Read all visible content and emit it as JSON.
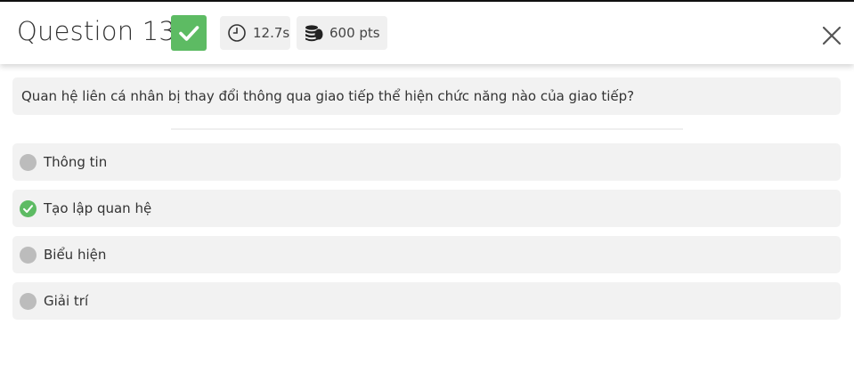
{
  "header": {
    "title": "Question 13",
    "status_icon": "check-icon",
    "time": "12.7s",
    "time_icon": "clock-icon",
    "points": "600 pts",
    "points_icon": "coins-icon",
    "close_icon": "close-icon"
  },
  "question": {
    "text": "Quan hệ liên cá nhân bị thay đổi thông qua giao tiếp thể hiện chức năng nào của giao tiếp?"
  },
  "options": [
    {
      "label": "Thông tin",
      "correct": false
    },
    {
      "label": "Tạo lập quan hệ",
      "correct": true
    },
    {
      "label": "Biểu hiện",
      "correct": false
    },
    {
      "label": "Giải trí",
      "correct": false
    }
  ],
  "colors": {
    "correct": "#5dbb63",
    "neutral_dot": "#bcbcbc",
    "panel_bg": "#f2f2f2"
  }
}
